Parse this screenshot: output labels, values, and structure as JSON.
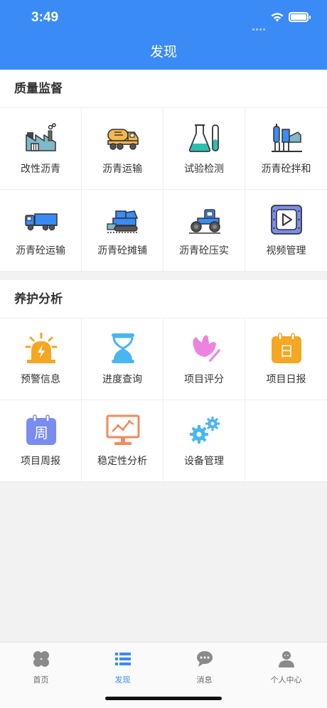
{
  "status": {
    "time": "3:49"
  },
  "nav": {
    "title": "发现"
  },
  "sections": [
    {
      "title": "质量监督",
      "items": [
        {
          "label": "改性沥青",
          "icon": "factory-icon"
        },
        {
          "label": "沥青运输",
          "icon": "tanker-truck-icon"
        },
        {
          "label": "试验检测",
          "icon": "lab-flask-icon"
        },
        {
          "label": "沥青砼拌和",
          "icon": "mixing-plant-icon"
        },
        {
          "label": "沥青砼运输",
          "icon": "dump-truck-icon"
        },
        {
          "label": "沥青砼摊铺",
          "icon": "paver-icon"
        },
        {
          "label": "沥青砼压实",
          "icon": "road-roller-icon"
        },
        {
          "label": "视频管理",
          "icon": "video-icon"
        }
      ]
    },
    {
      "title": "养护分析",
      "items": [
        {
          "label": "预警信息",
          "icon": "alarm-light-icon"
        },
        {
          "label": "进度查询",
          "icon": "hourglass-icon"
        },
        {
          "label": "项目评分",
          "icon": "flower-pen-icon"
        },
        {
          "label": "项目日报",
          "icon": "daily-calendar-icon",
          "glyph": "日"
        },
        {
          "label": "项目周报",
          "icon": "weekly-calendar-icon",
          "glyph": "周"
        },
        {
          "label": "稳定性分析",
          "icon": "monitor-chart-icon"
        },
        {
          "label": "设备管理",
          "icon": "gears-icon"
        }
      ]
    }
  ],
  "tabs": [
    {
      "label": "首页",
      "icon": "clover-icon",
      "active": false
    },
    {
      "label": "发现",
      "icon": "list-icon",
      "active": true
    },
    {
      "label": "消息",
      "icon": "chat-bubble-icon",
      "active": false
    },
    {
      "label": "个人中心",
      "icon": "person-icon",
      "active": false
    }
  ],
  "colors": {
    "primary": "#3a8bf6",
    "orange": "#f5a623",
    "pink": "#ee82e0",
    "purple": "#7b8cf0",
    "teal": "#2bbfb0"
  }
}
